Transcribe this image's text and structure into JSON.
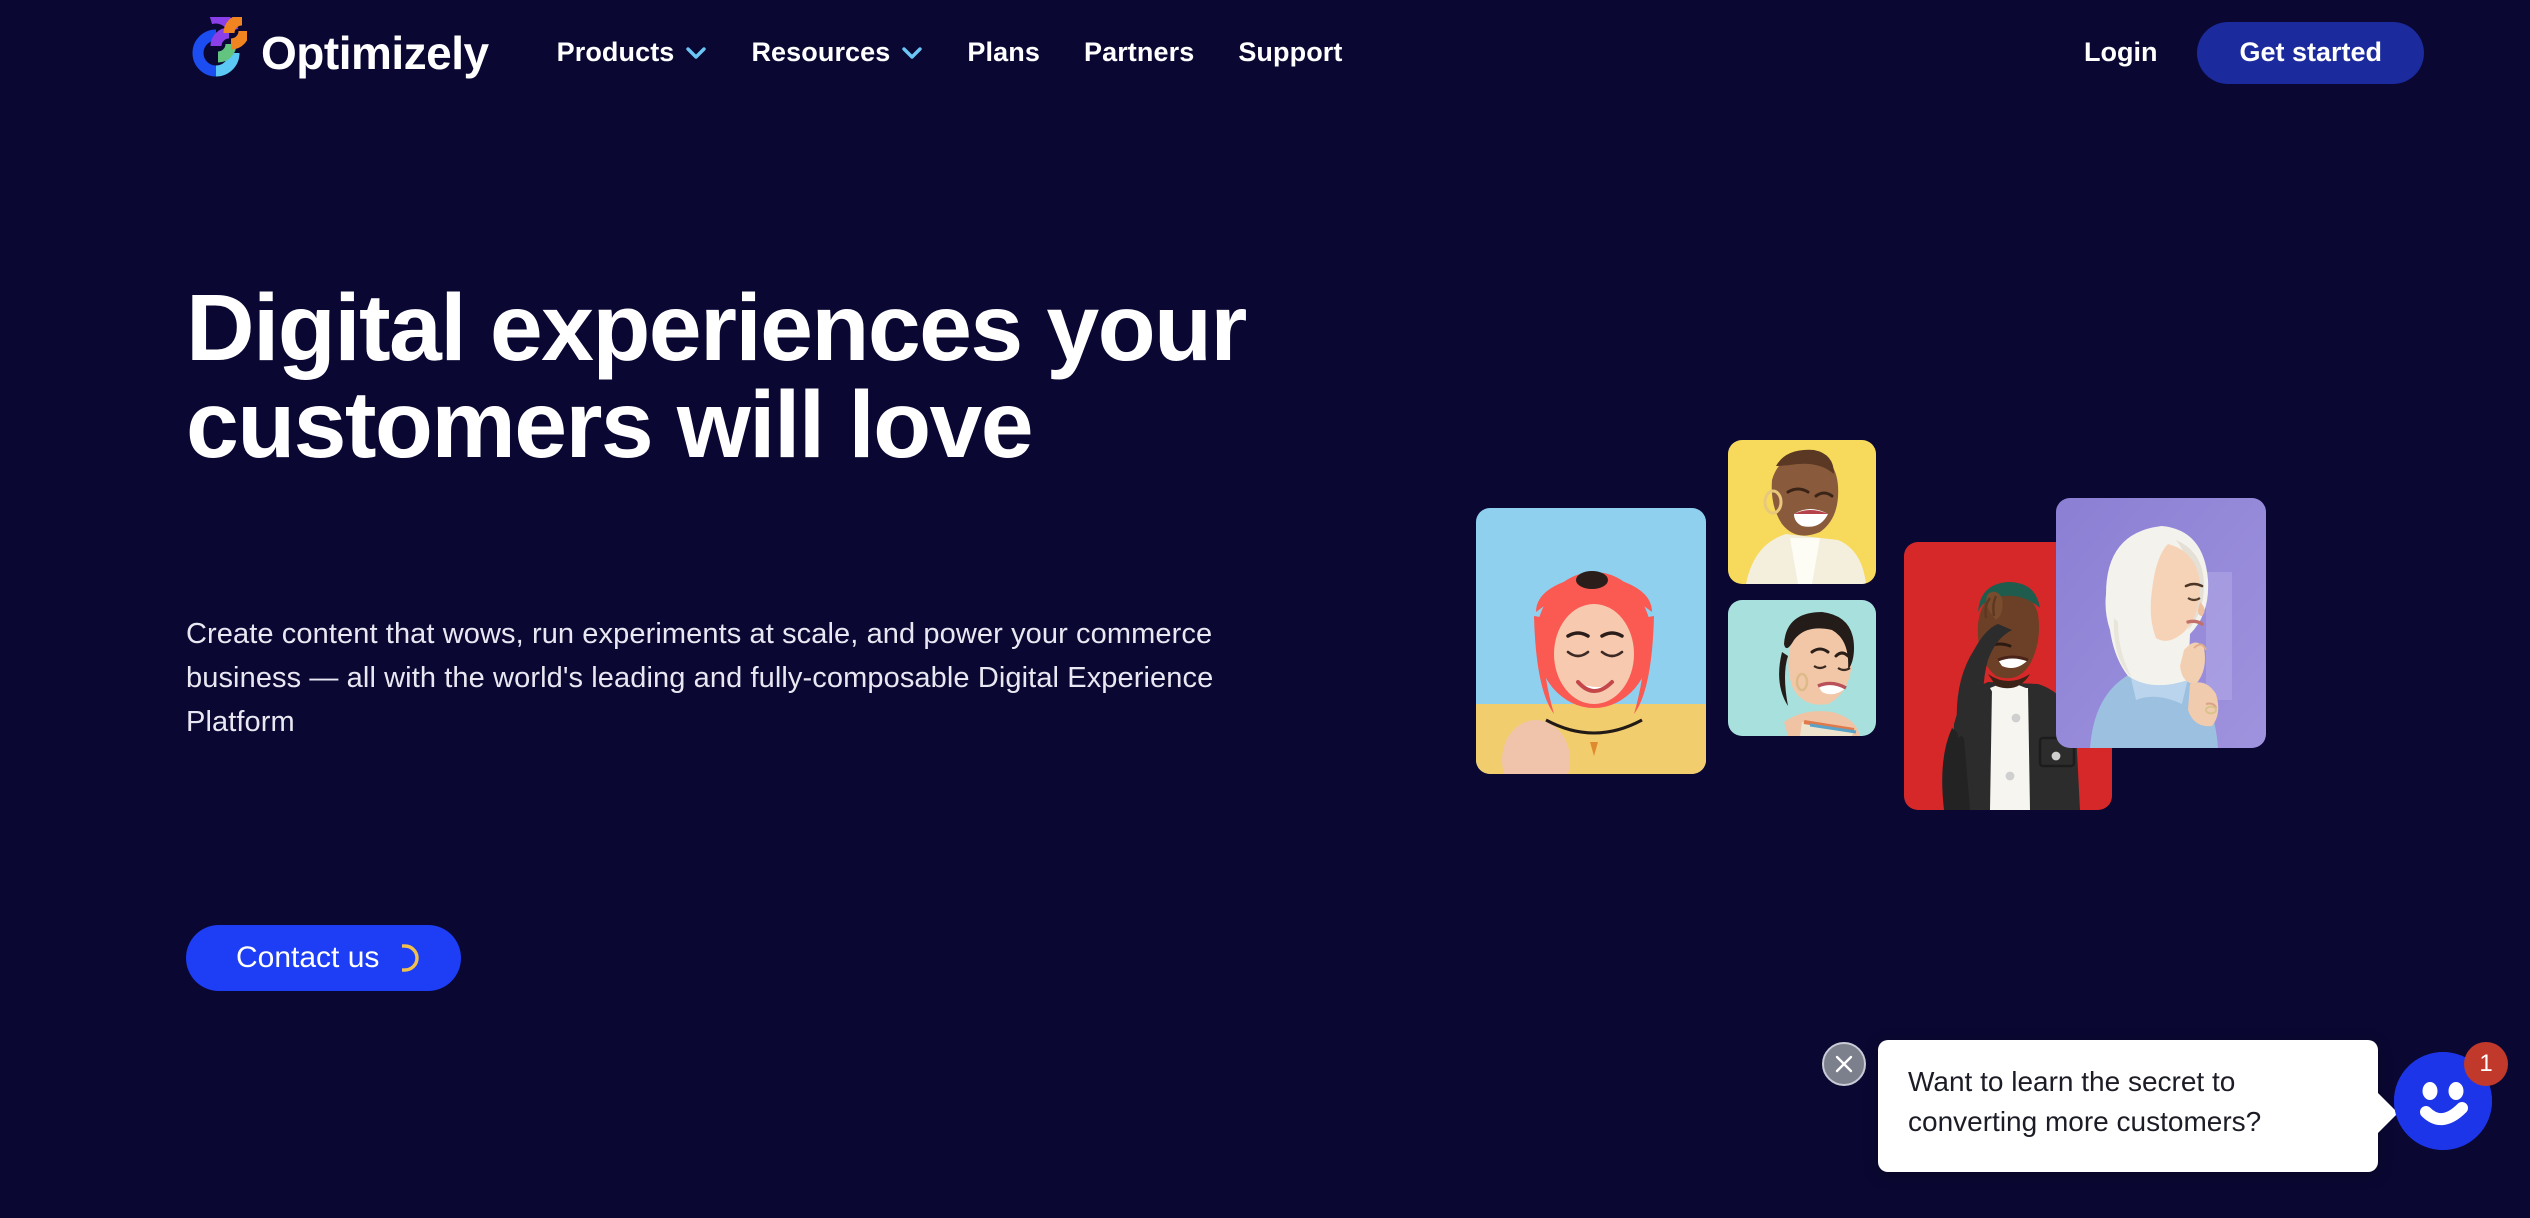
{
  "colors": {
    "page_background": "#0a0833",
    "accent_blue": "#1d3ef5",
    "cta_blue": "#1b2a9c",
    "chevron_blue": "#6bc6f5",
    "arc_yellow": "#f2c14b",
    "chat_blue": "#1d35e8",
    "badge_red": "#c0392b"
  },
  "header": {
    "brand": {
      "name": "Optimizely",
      "logo_icon": "optimizely-logo-mark"
    },
    "nav": [
      {
        "label": "Products",
        "has_dropdown": true,
        "icon": "chevron-down-icon"
      },
      {
        "label": "Resources",
        "has_dropdown": true,
        "icon": "chevron-down-icon"
      },
      {
        "label": "Plans",
        "has_dropdown": false
      },
      {
        "label": "Partners",
        "has_dropdown": false
      },
      {
        "label": "Support",
        "has_dropdown": false
      }
    ],
    "login_label": "Login",
    "cta_label": "Get started"
  },
  "hero": {
    "title_line_1": "Digital experiences your",
    "title_line_2": "customers will love",
    "subtitle": "Create content that wows, run experiments at scale, and power your commerce business — all with the world's leading and fully-composable Digital Experience Platform",
    "contact_label": "Contact us",
    "contact_icon": "arc-loader-icon"
  },
  "collage": {
    "cards": [
      {
        "name": "photo-card-pink-hair-woman",
        "background": "#8fd0ef",
        "description": "Smiling woman with pink hair on light blue background"
      },
      {
        "name": "photo-card-laughing-woman-yellow",
        "background": "#f7d95c",
        "description": "Laughing woman on yellow background"
      },
      {
        "name": "photo-card-smiling-woman-mint",
        "background": "#a8e0dd",
        "description": "Smiling woman on mint background"
      },
      {
        "name": "photo-card-smiling-man-red",
        "background": "#d62828",
        "description": "Smiling man with hand on face on red background"
      },
      {
        "name": "photo-card-woman-hijab-purple",
        "background": "#8b7fd4",
        "description": "Woman in white hijab on purple background"
      }
    ]
  },
  "chat_widget": {
    "close_icon": "close-icon",
    "message": "Want to learn the secret to converting more customers?",
    "launcher_icon": "smiley-chat-icon",
    "badge_count": "1"
  }
}
